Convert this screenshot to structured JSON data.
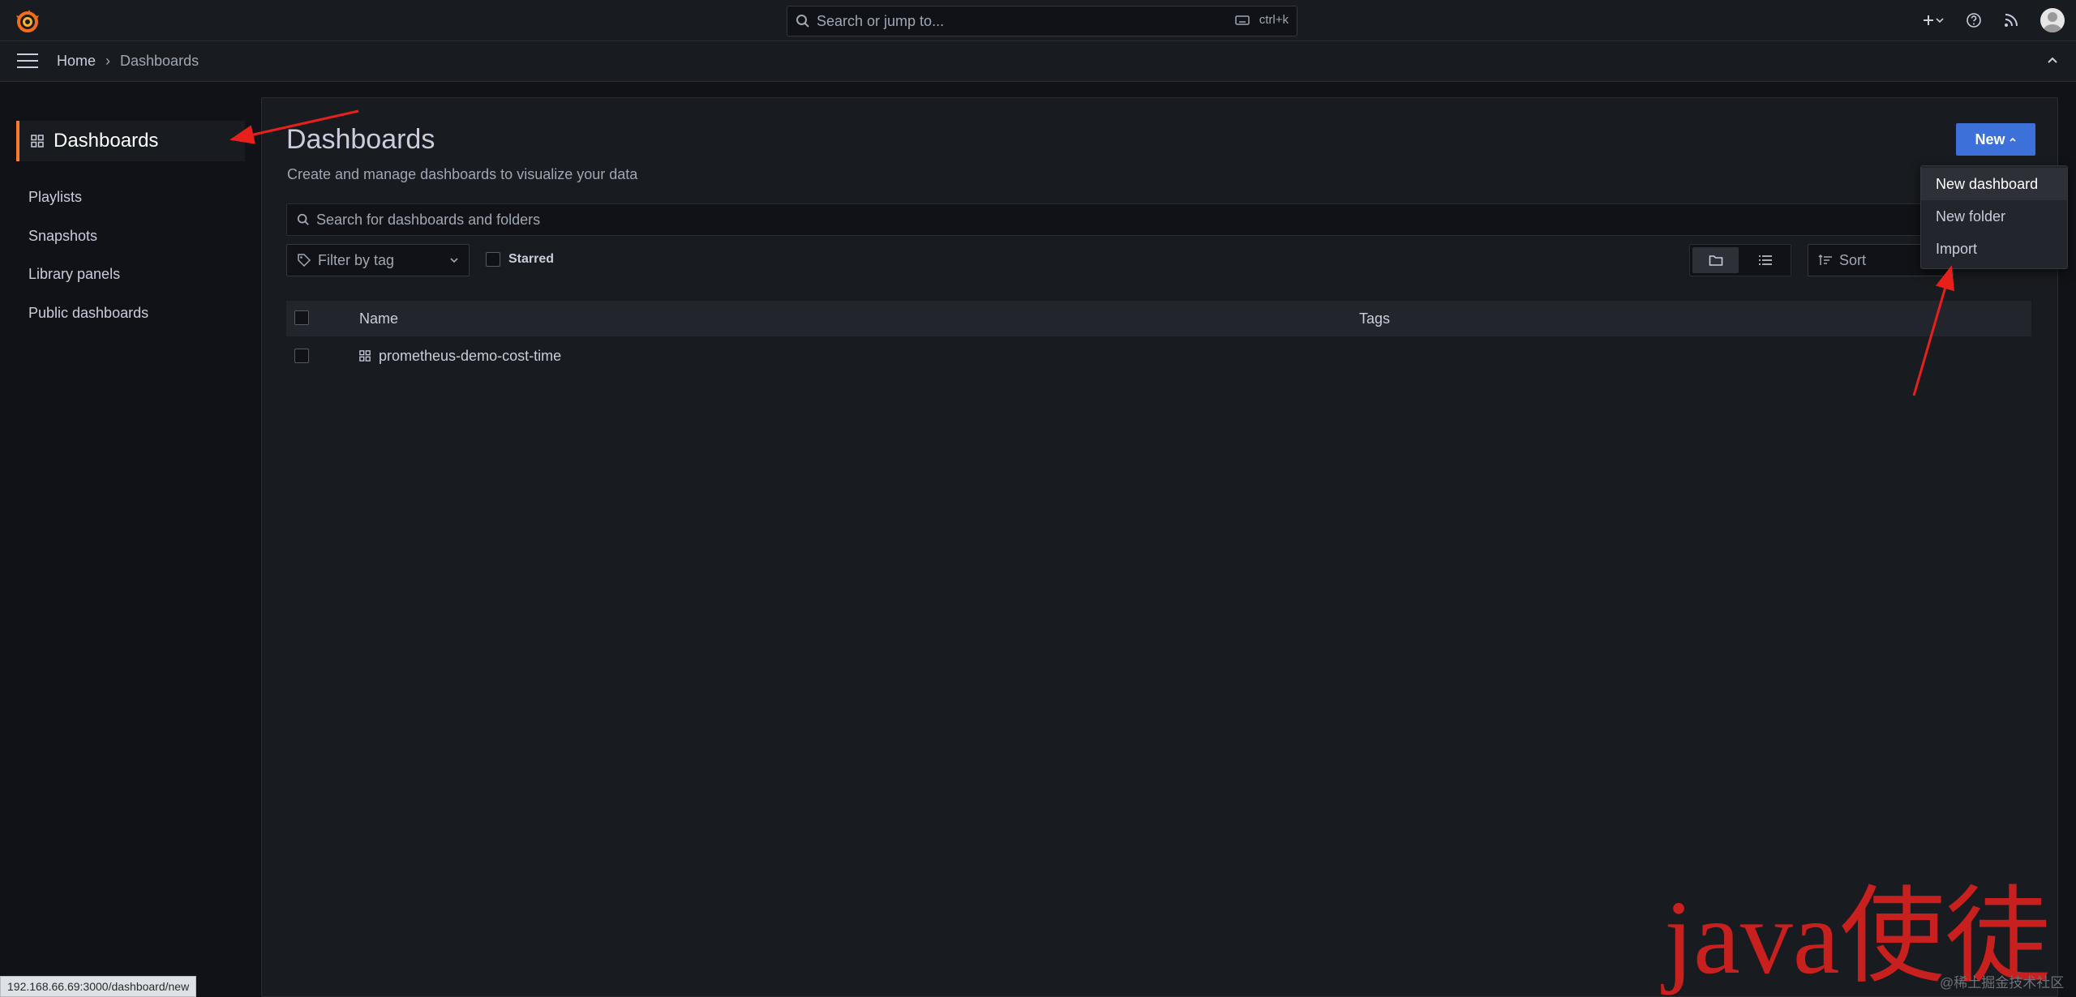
{
  "topbar": {
    "search_placeholder": "Search or jump to...",
    "search_shortcut": "ctrl+k"
  },
  "breadcrumb": {
    "home": "Home",
    "separator": "›",
    "current": "Dashboards"
  },
  "sidebar": {
    "active": "Dashboards",
    "items": [
      {
        "label": "Playlists"
      },
      {
        "label": "Snapshots"
      },
      {
        "label": "Library panels"
      },
      {
        "label": "Public dashboards"
      }
    ]
  },
  "main": {
    "title": "Dashboards",
    "subtitle": "Create and manage dashboards to visualize your data",
    "new_button": "New",
    "search_placeholder": "Search for dashboards and folders",
    "tag_filter_placeholder": "Filter by tag",
    "starred_label": "Starred",
    "sort_label": "Sort",
    "table": {
      "columns": [
        "Name",
        "Tags"
      ],
      "rows": [
        {
          "name": "prometheus-demo-cost-time",
          "tags": ""
        }
      ]
    }
  },
  "new_menu": {
    "items": [
      {
        "label": "New dashboard"
      },
      {
        "label": "New folder"
      },
      {
        "label": "Import"
      }
    ]
  },
  "status_url": "192.168.66.69:3000/dashboard/new",
  "watermark": {
    "main": "java使徒",
    "small": "@稀土掘金技术社区"
  },
  "colors": {
    "accent": "#ff7a27",
    "primary_button": "#3d71d9",
    "annotation_arrow": "#e8201c"
  }
}
